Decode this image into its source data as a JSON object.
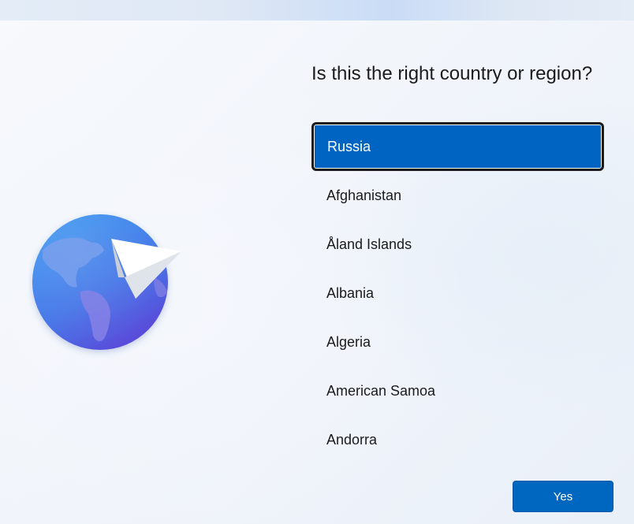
{
  "page": {
    "title": "Is this the right country or region?"
  },
  "country_list": {
    "selected_index": 0,
    "items": [
      {
        "label": "Russia",
        "selected": true
      },
      {
        "label": "Afghanistan",
        "selected": false
      },
      {
        "label": "Åland Islands",
        "selected": false
      },
      {
        "label": "Albania",
        "selected": false
      },
      {
        "label": "Algeria",
        "selected": false
      },
      {
        "label": "American Samoa",
        "selected": false
      },
      {
        "label": "Andorra",
        "selected": false
      }
    ]
  },
  "actions": {
    "yes_label": "Yes"
  },
  "illustration": {
    "icon": "globe-with-paper-plane-icon"
  },
  "colors": {
    "accent": "#0067c0",
    "selected_bg": "#0064c2",
    "text": "#1b1b1b",
    "globe_light": "#3d8ee8",
    "globe_dark": "#5b3fd6"
  }
}
